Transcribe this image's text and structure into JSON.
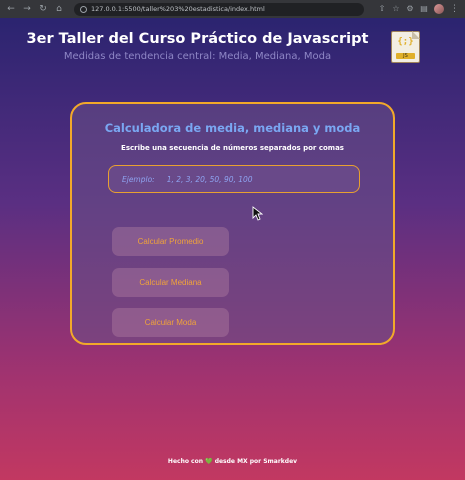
{
  "browser": {
    "url": "127.0.0.1:5500/taller%203%20estadistica/index.html",
    "back_icon": "arrow-left",
    "forward_icon": "arrow-right",
    "reload_icon": "reload",
    "home_icon": "home"
  },
  "header": {
    "title": "3er Taller del Curso Práctico de Javascript",
    "subtitle": "Medidas de tendencia central: Media, Mediana, Moda",
    "logo": {
      "braces": "{;}",
      "tag": "JS"
    }
  },
  "calculator": {
    "title": "Calculadora de media, mediana y moda",
    "instructions": "Escribe una secuencia de números separados por comas",
    "input": {
      "placeholder_label": "Ejemplo:",
      "placeholder_value": "1, 2, 3, 20, 50, 90, 100"
    },
    "buttons": {
      "promedio": "Calcular Promedio",
      "mediana": "Calcular Mediana",
      "moda": "Calcular Moda"
    }
  },
  "footer": {
    "before": "Hecho con",
    "heart": "💚",
    "after": "desde MX por Smarkdev"
  },
  "colors": {
    "accent_border": "#f2a92a",
    "title_blue": "#7aa7f2",
    "button_text": "#f0a33a"
  }
}
